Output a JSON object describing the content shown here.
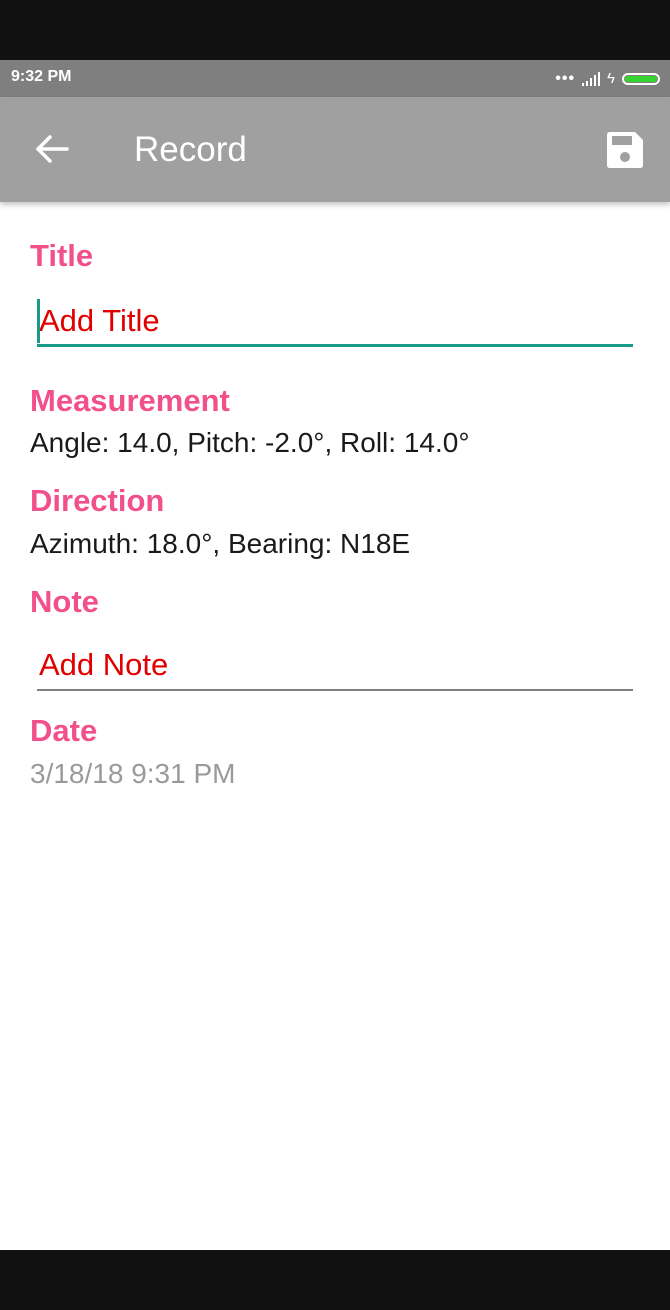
{
  "status_bar": {
    "time": "9:32 PM",
    "dots": "•••",
    "icons": [
      "signal-icon",
      "charging-icon",
      "battery-icon"
    ],
    "battery_color": "#35d42f"
  },
  "app_bar": {
    "title": "Record",
    "back_icon": "arrow-left-icon",
    "save_icon": "floppy-disk-icon",
    "background": "#a0a0a0"
  },
  "form": {
    "title": {
      "label": "Title",
      "placeholder": "Add Title",
      "value": ""
    },
    "measurement": {
      "label": "Measurement",
      "value": "Angle: 14.0,  Pitch: -2.0°, Roll: 14.0°"
    },
    "direction": {
      "label": "Direction",
      "value": "Azimuth: 18.0°, Bearing: N18E"
    },
    "note": {
      "label": "Note",
      "placeholder": "Add Note",
      "value": ""
    },
    "date": {
      "label": "Date",
      "value": "3/18/18 9:31 PM"
    }
  },
  "colors": {
    "label": "#f2508a",
    "placeholder": "#e00000",
    "focus_underline": "#1a9a8a"
  }
}
